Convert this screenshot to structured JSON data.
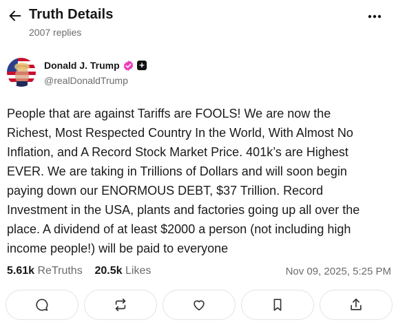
{
  "header": {
    "title": "Truth Details",
    "replies": "2007 replies"
  },
  "author": {
    "name": "Donald J. Trump",
    "handle": "@realDonaldTrump",
    "badge_plus": "+"
  },
  "post": {
    "lines": [
      "People that are against Tariffs are FOOLS! We are now the",
      "Richest, Most Respected Country In the World, With Almost No",
      "Inflation, and A Record Stock Market Price. 401k’s are Highest",
      "EVER. We are taking in Trillions of Dollars and will soon begin",
      "paying down our ENORMOUS DEBT, $37 Trillion. Record",
      "Investment in the USA, plants and factories going up all over the",
      "place. A dividend of at least $2000 a person (not including high",
      "income people!) will be paid to everyone"
    ]
  },
  "stats": {
    "retruths_count": "5.61k",
    "retruths_label": "ReTruths",
    "likes_count": "20.5k",
    "likes_label": "Likes",
    "timestamp": "Nov 09, 2025, 5:25 PM"
  },
  "actions": [
    "reply-icon",
    "retruth-icon",
    "heart-icon",
    "bookmark-icon",
    "share-icon"
  ],
  "colors": {
    "verified": "#e93dbb",
    "text": "#161616",
    "muted": "#6b6b6b",
    "border": "#e3e3e3"
  }
}
